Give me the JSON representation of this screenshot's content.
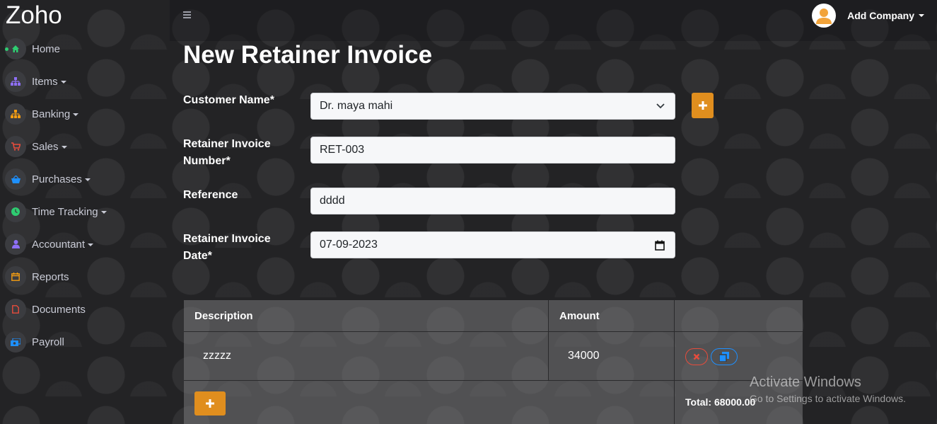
{
  "app": {
    "brand": "Zoho"
  },
  "sidebar": {
    "items": [
      {
        "label": "Home",
        "icon": "home-icon",
        "color": "#2ecc71",
        "caret": false
      },
      {
        "label": "Items",
        "icon": "sitemap-icon",
        "color": "#8e6ff7",
        "caret": true
      },
      {
        "label": "Banking",
        "icon": "bank-icon",
        "color": "#f39c12",
        "caret": true
      },
      {
        "label": "Sales",
        "icon": "cart-icon",
        "color": "#e74c3c",
        "caret": true
      },
      {
        "label": "Purchases",
        "icon": "basket-icon",
        "color": "#1e90ff",
        "caret": true
      },
      {
        "label": "Time Tracking",
        "icon": "clock-icon",
        "color": "#2ecc71",
        "caret": true
      },
      {
        "label": "Accountant",
        "icon": "user-icon",
        "color": "#8e6ff7",
        "caret": true
      },
      {
        "label": "Reports",
        "icon": "calendar-icon",
        "color": "#f39c12",
        "caret": false
      },
      {
        "label": "Documents",
        "icon": "document-icon",
        "color": "#e74c3c",
        "caret": false
      },
      {
        "label": "Payroll",
        "icon": "money-icon",
        "color": "#1e90ff",
        "caret": false
      }
    ]
  },
  "header": {
    "user_label": "Add Company"
  },
  "page": {
    "title": "New Retainer Invoice"
  },
  "form": {
    "customer_label": "Customer Name*",
    "customer_value": "Dr. maya mahi",
    "invoice_number_label": "Retainer Invoice Number*",
    "invoice_number_value": "RET-003",
    "reference_label": "Reference",
    "reference_value": "dddd",
    "date_label": "Retainer Invoice Date*",
    "date_value": "07-09-2023"
  },
  "table": {
    "headers": [
      "Description",
      "Amount",
      ""
    ],
    "rows": [
      {
        "description": "zzzzz",
        "amount": "34000"
      }
    ],
    "total": "Total: 68000.00"
  },
  "watermark": {
    "line1": "Activate Windows",
    "line2": "Go to Settings to activate Windows."
  },
  "colors": {
    "accent": "#e08e1e",
    "danger": "#e74c3c",
    "info": "#1e90ff"
  }
}
